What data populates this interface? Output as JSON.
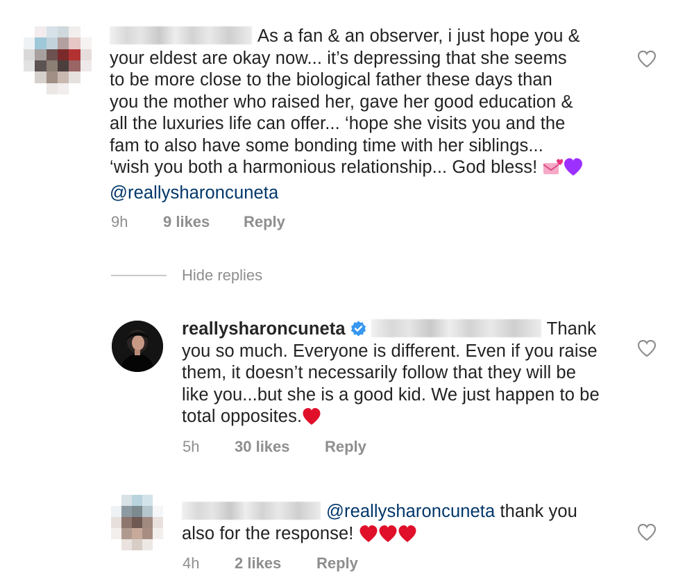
{
  "comments": [
    {
      "text_lead": "As a fan & an observer, i just hope you &",
      "text_lines": [
        "your eldest are okay now... it’s depressing that she seems",
        "to be more close to the biological father these days than",
        "you the mother who raised her, gave her good education &",
        "all the luxuries life can offer... ‘hope she visits you and the",
        "fam to also have some bonding time with her siblings...",
        "‘wish you both a harmonious relationship... God bless!"
      ],
      "mention": "@reallysharoncuneta",
      "time": "9h",
      "likes": "9 likes",
      "reply": "Reply",
      "emoji": [
        "love-letter",
        "purple-heart"
      ]
    },
    {
      "username": "reallysharoncuneta",
      "text_lead": "Thank",
      "text_lines": [
        "you so much. Everyone is different. Even if you raise",
        "them, it doesn’t necessarily follow that they will be",
        "like you...but she is a good kid. We just happen to be",
        "total opposites."
      ],
      "time": "5h",
      "likes": "30 likes",
      "reply": "Reply",
      "emoji": [
        "red-heart"
      ]
    },
    {
      "mention": "@reallysharoncuneta",
      "text_lead": "thank you",
      "text_lines": [
        "also for the response!"
      ],
      "time": "4h",
      "likes": "2 likes",
      "reply": "Reply",
      "emoji": [
        "red-heart",
        "red-heart",
        "red-heart"
      ]
    }
  ],
  "hide_replies": "Hide replies",
  "colors": {
    "text": "#262626",
    "meta": "#8e8e8e",
    "mention": "#00376b",
    "verified": "#3897f0",
    "heart": "#e0102a"
  }
}
